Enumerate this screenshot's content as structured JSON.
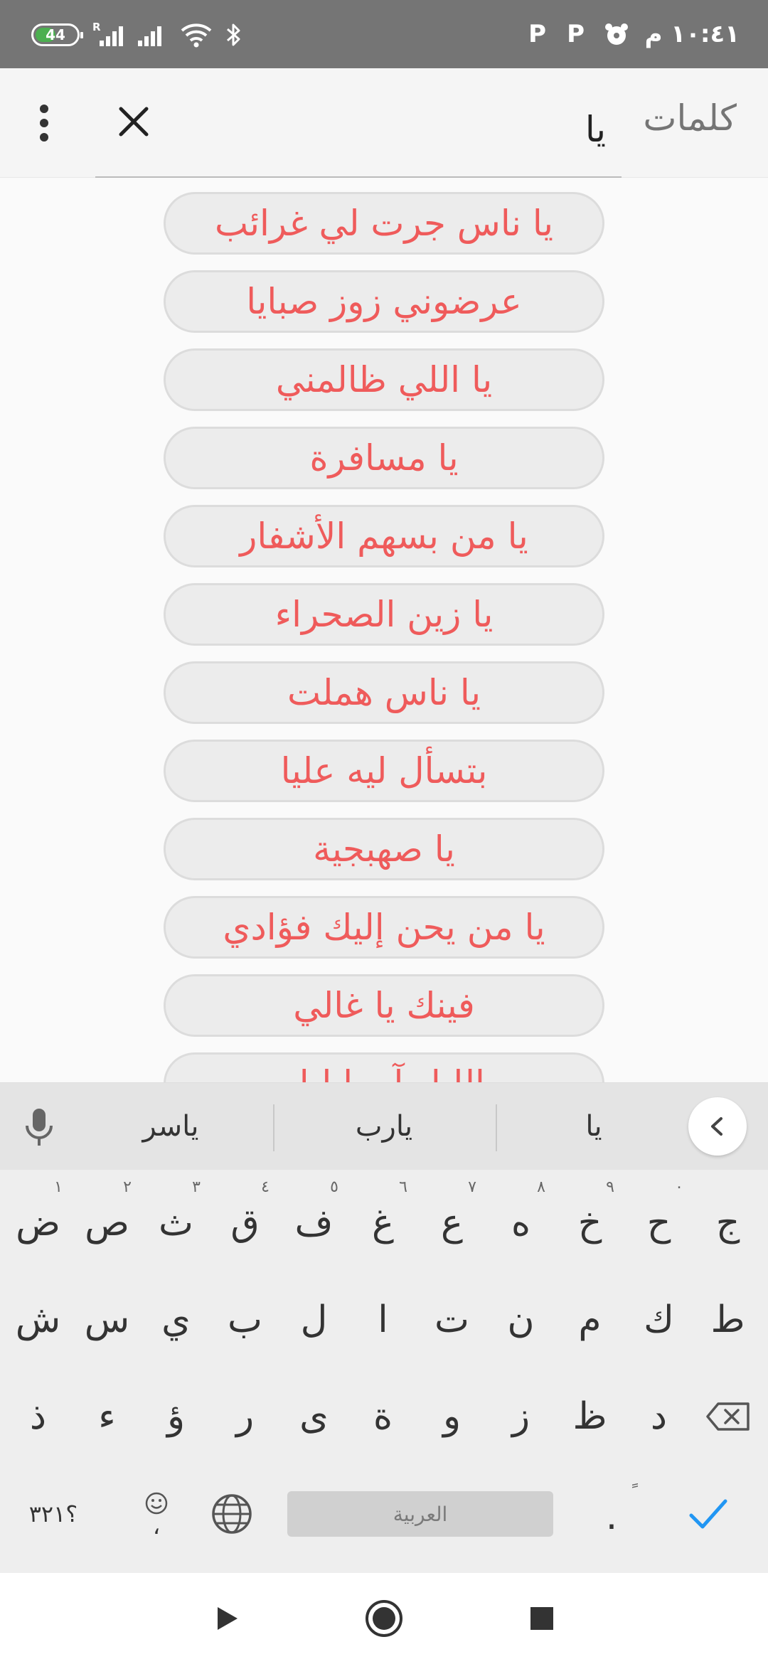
{
  "status_bar": {
    "battery_level": "44",
    "roaming_indicator": "R",
    "time": "١٠:٤١ م",
    "notification_icons": [
      "P",
      "P"
    ],
    "accent_battery": "#4caf50"
  },
  "app_bar": {
    "search_value": "يا",
    "search_label": "كلمات",
    "clear_icon": "close-icon",
    "menu_icon": "more-vert-icon"
  },
  "results": [
    "يا ناس جرت لي غرائب",
    "عرضوني زوز صبايا",
    "يا اللي ظالمني",
    "يا مسافرة",
    "يا من بسهم الأشفار",
    "يا زين الصحراء",
    "يا ناس هملت",
    "بتسأل ليه عليا",
    "يا صهبجية",
    "يا من يحن إليك فؤادي",
    "فينك يا غالي",
    "الليل آه يا ليل"
  ],
  "keyboard": {
    "suggestions": [
      "ياسر",
      "يارب",
      "يا"
    ],
    "row1": [
      {
        "key": "ض",
        "sup": "١"
      },
      {
        "key": "ص",
        "sup": "٢"
      },
      {
        "key": "ث",
        "sup": "٣"
      },
      {
        "key": "ق",
        "sup": "٤"
      },
      {
        "key": "ف",
        "sup": "٥"
      },
      {
        "key": "غ",
        "sup": "٦"
      },
      {
        "key": "ع",
        "sup": "٧"
      },
      {
        "key": "ه",
        "sup": "٨"
      },
      {
        "key": "خ",
        "sup": "٩"
      },
      {
        "key": "ح",
        "sup": "٠"
      },
      {
        "key": "ج",
        "sup": ""
      }
    ],
    "row2": [
      "ش",
      "س",
      "ي",
      "ب",
      "ل",
      "ا",
      "ت",
      "ن",
      "م",
      "ك",
      "ط"
    ],
    "row3": [
      "ذ",
      "ء",
      "ؤ",
      "ر",
      "ى",
      "ة",
      "و",
      "ز",
      "ظ",
      "د"
    ],
    "symbols_label": "؟٣٢١",
    "emoji_comma": "،",
    "space_label": "العربية",
    "period": ".",
    "period_sup": "ً",
    "accent_enter": "#2196f3"
  }
}
